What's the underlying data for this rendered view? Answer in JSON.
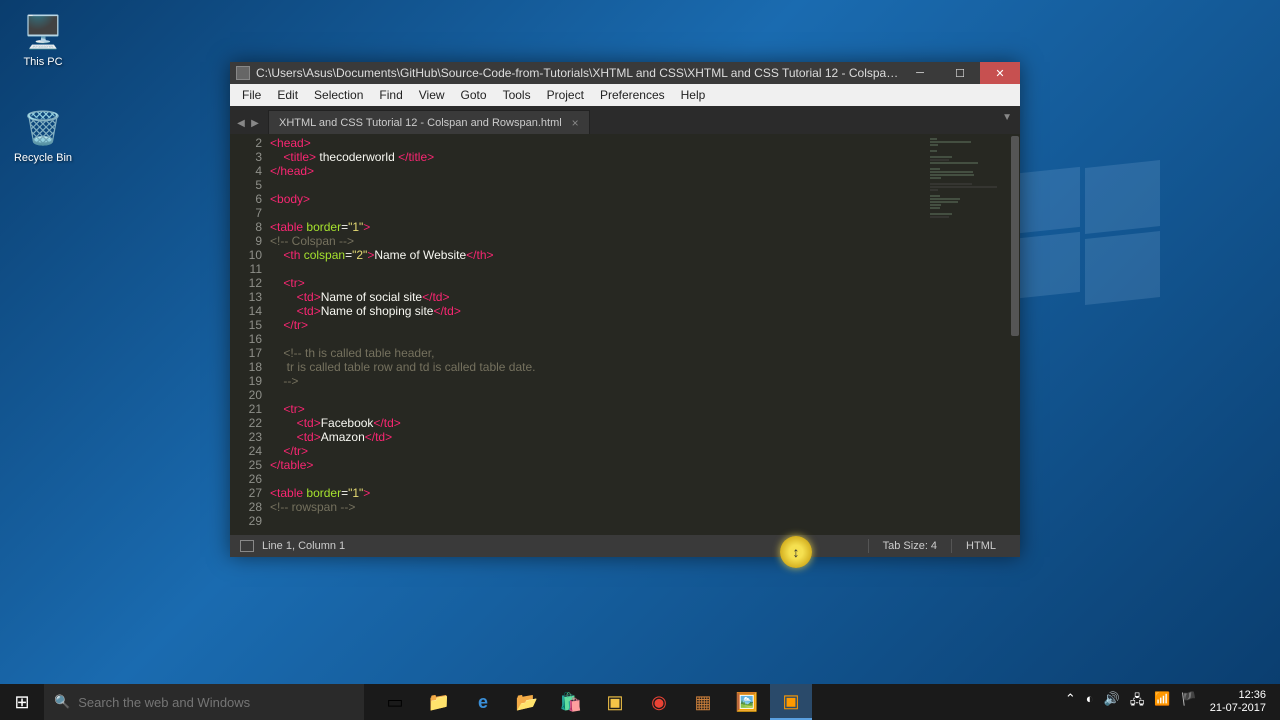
{
  "desktop_icons": [
    {
      "name": "This PC",
      "icon": "🖥️"
    },
    {
      "name": "Recycle Bin",
      "icon": "🗑️"
    }
  ],
  "window": {
    "title": "C:\\Users\\Asus\\Documents\\GitHub\\Source-Code-from-Tutorials\\XHTML and CSS\\XHTML and CSS Tutorial 12 - Colspan and ...",
    "menu": [
      "File",
      "Edit",
      "Selection",
      "Find",
      "View",
      "Goto",
      "Tools",
      "Project",
      "Preferences",
      "Help"
    ],
    "tab": "XHTML and CSS Tutorial 12 - Colspan and Rowspan.html",
    "line_start": 2,
    "status": {
      "position": "Line 1, Column 1",
      "tab_size": "Tab Size: 4",
      "language": "HTML"
    },
    "code": [
      [
        [
          "<",
          "tag"
        ],
        [
          "head",
          "tag"
        ],
        [
          ">",
          "tag"
        ]
      ],
      [
        [
          "    ",
          ""
        ],
        [
          "<",
          "tag"
        ],
        [
          "title",
          "tag"
        ],
        [
          ">",
          "tag"
        ],
        [
          " thecoderworld ",
          "txt"
        ],
        [
          "</",
          "tag"
        ],
        [
          "title",
          "tag"
        ],
        [
          ">",
          "tag"
        ]
      ],
      [
        [
          "</",
          "tag"
        ],
        [
          "head",
          "tag"
        ],
        [
          ">",
          "tag"
        ]
      ],
      [
        [
          "",
          ""
        ]
      ],
      [
        [
          "<",
          "tag"
        ],
        [
          "body",
          "tag"
        ],
        [
          ">",
          "tag"
        ]
      ],
      [
        [
          "",
          ""
        ]
      ],
      [
        [
          "<",
          "tag"
        ],
        [
          "table",
          "tag"
        ],
        [
          " ",
          ""
        ],
        [
          "border",
          "attr"
        ],
        [
          "=",
          "txt"
        ],
        [
          "\"1\"",
          "str"
        ],
        [
          ">",
          "tag"
        ]
      ],
      [
        [
          "<!-- Colspan -->",
          "com"
        ]
      ],
      [
        [
          "    ",
          ""
        ],
        [
          "<",
          "tag"
        ],
        [
          "th",
          "tag"
        ],
        [
          " ",
          ""
        ],
        [
          "colspan",
          "attr"
        ],
        [
          "=",
          "txt"
        ],
        [
          "\"2\"",
          "str"
        ],
        [
          ">",
          "tag"
        ],
        [
          "Name of Website",
          "txt"
        ],
        [
          "</",
          "tag"
        ],
        [
          "th",
          "tag"
        ],
        [
          ">",
          "tag"
        ]
      ],
      [
        [
          "",
          ""
        ]
      ],
      [
        [
          "    ",
          ""
        ],
        [
          "<",
          "tag"
        ],
        [
          "tr",
          "tag"
        ],
        [
          ">",
          "tag"
        ]
      ],
      [
        [
          "        ",
          ""
        ],
        [
          "<",
          "tag"
        ],
        [
          "td",
          "tag"
        ],
        [
          ">",
          "tag"
        ],
        [
          "Name of social site",
          "txt"
        ],
        [
          "</",
          "tag"
        ],
        [
          "td",
          "tag"
        ],
        [
          ">",
          "tag"
        ]
      ],
      [
        [
          "        ",
          ""
        ],
        [
          "<",
          "tag"
        ],
        [
          "td",
          "tag"
        ],
        [
          ">",
          "tag"
        ],
        [
          "Name of shoping site",
          "txt"
        ],
        [
          "</",
          "tag"
        ],
        [
          "td",
          "tag"
        ],
        [
          ">",
          "tag"
        ]
      ],
      [
        [
          "    ",
          ""
        ],
        [
          "</",
          "tag"
        ],
        [
          "tr",
          "tag"
        ],
        [
          ">",
          "tag"
        ]
      ],
      [
        [
          "",
          ""
        ]
      ],
      [
        [
          "    ",
          ""
        ],
        [
          "<!-- th is called table header,",
          "com"
        ]
      ],
      [
        [
          "     tr is called table row and td is called table date.",
          "com"
        ]
      ],
      [
        [
          "    -->",
          "com"
        ]
      ],
      [
        [
          "",
          ""
        ]
      ],
      [
        [
          "    ",
          ""
        ],
        [
          "<",
          "tag"
        ],
        [
          "tr",
          "tag"
        ],
        [
          ">",
          "tag"
        ]
      ],
      [
        [
          "        ",
          ""
        ],
        [
          "<",
          "tag"
        ],
        [
          "td",
          "tag"
        ],
        [
          ">",
          "tag"
        ],
        [
          "Facebook",
          "txt"
        ],
        [
          "</",
          "tag"
        ],
        [
          "td",
          "tag"
        ],
        [
          ">",
          "tag"
        ]
      ],
      [
        [
          "        ",
          ""
        ],
        [
          "<",
          "tag"
        ],
        [
          "td",
          "tag"
        ],
        [
          ">",
          "tag"
        ],
        [
          "Amazon",
          "txt"
        ],
        [
          "</",
          "tag"
        ],
        [
          "td",
          "tag"
        ],
        [
          ">",
          "tag"
        ]
      ],
      [
        [
          "    ",
          ""
        ],
        [
          "</",
          "tag"
        ],
        [
          "tr",
          "tag"
        ],
        [
          ">",
          "tag"
        ]
      ],
      [
        [
          "</",
          "tag"
        ],
        [
          "table",
          "tag"
        ],
        [
          ">",
          "tag"
        ]
      ],
      [
        [
          "",
          ""
        ]
      ],
      [
        [
          "<",
          "tag"
        ],
        [
          "table",
          "tag"
        ],
        [
          " ",
          ""
        ],
        [
          "border",
          "attr"
        ],
        [
          "=",
          "txt"
        ],
        [
          "\"1\"",
          "str"
        ],
        [
          ">",
          "tag"
        ]
      ],
      [
        [
          "<!-- rowspan -->",
          "com"
        ]
      ],
      [
        [
          "",
          ""
        ]
      ]
    ]
  },
  "taskbar": {
    "search_placeholder": "Search the web and Windows",
    "icons": [
      {
        "glyph": "▭",
        "name": "task-view"
      },
      {
        "glyph": "📁",
        "name": "app-1",
        "style": "color:#ff7a00"
      },
      {
        "glyph": "e",
        "name": "edge",
        "style": "color:#3a8fd8;font-weight:bold"
      },
      {
        "glyph": "📂",
        "name": "explorer",
        "style": "color:#f5c547"
      },
      {
        "glyph": "🛍️",
        "name": "store"
      },
      {
        "glyph": "▣",
        "name": "app-2",
        "style": "color:#f5c547"
      },
      {
        "glyph": "◉",
        "name": "chrome",
        "style": "color:#ea4335"
      },
      {
        "glyph": "▦",
        "name": "app-3",
        "style": "color:#c77d3a"
      },
      {
        "glyph": "🖼️",
        "name": "app-4",
        "style": "color:#5aa0e0"
      },
      {
        "glyph": "▣",
        "name": "sublime",
        "style": "color:#ff9a00",
        "active": true
      }
    ],
    "tray_icons": [
      "⌃",
      "◐",
      "🔊",
      "🖧",
      "📶",
      "🏴"
    ],
    "time": "12:36",
    "date": "21-07-2017"
  }
}
